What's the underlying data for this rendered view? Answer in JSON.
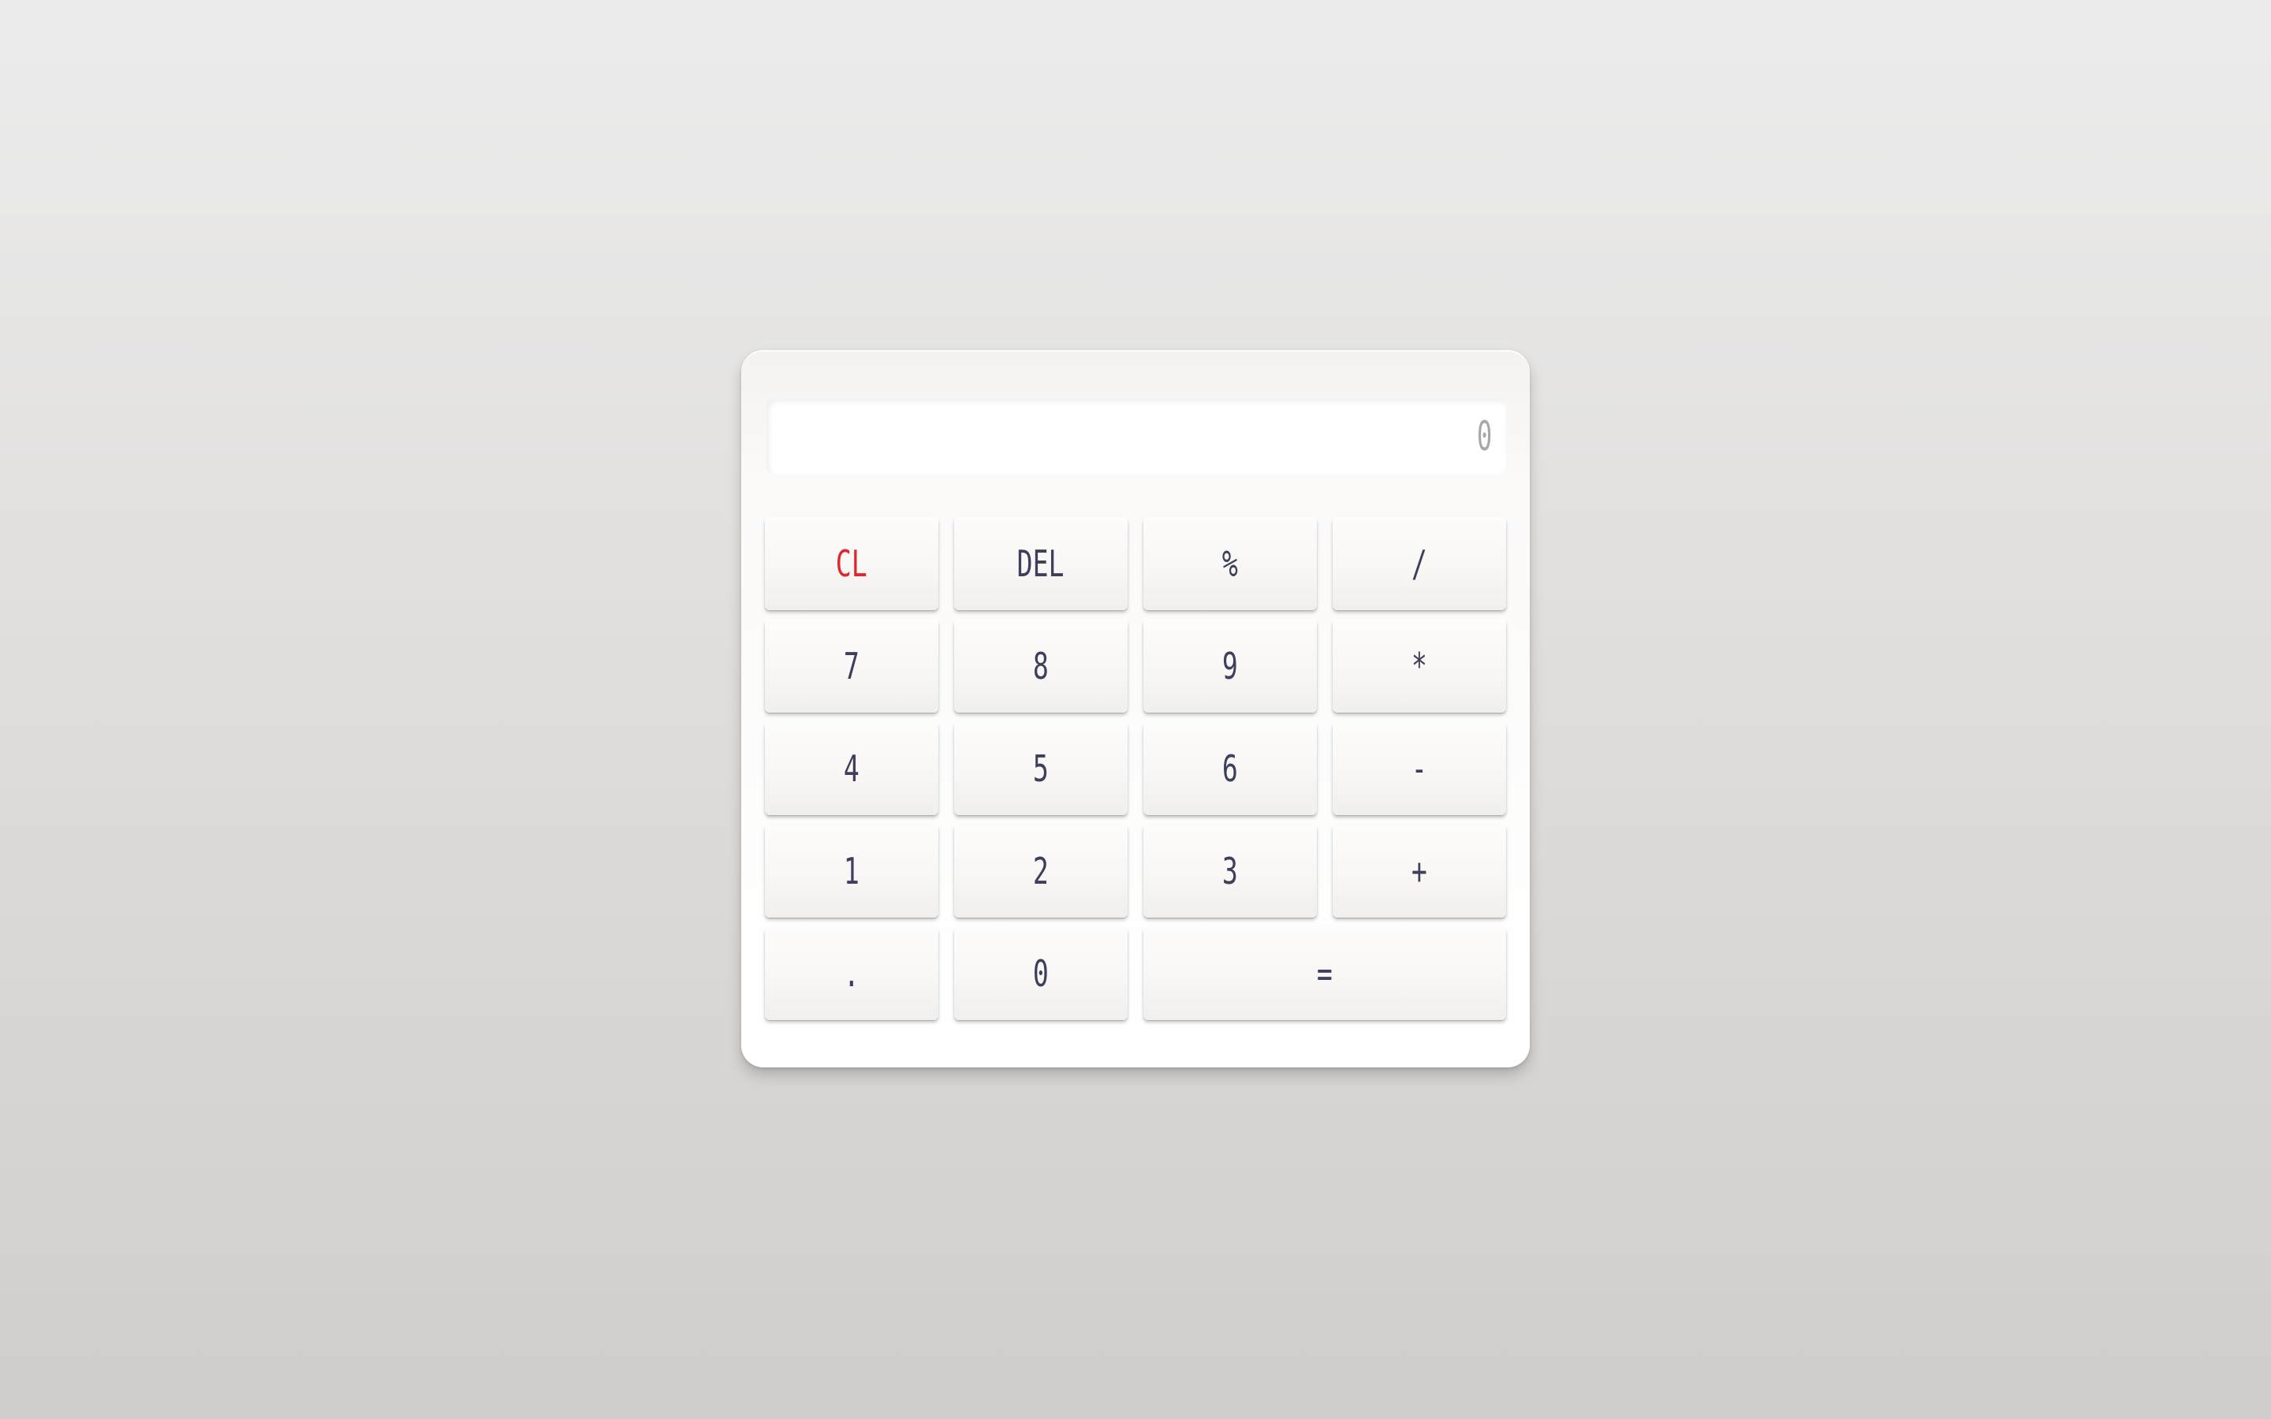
{
  "calculator": {
    "display": {
      "value": "0"
    },
    "keys": [
      {
        "label": "CL",
        "name": "clear-button",
        "style": "danger"
      },
      {
        "label": "DEL",
        "name": "delete-button",
        "style": "normal"
      },
      {
        "label": "%",
        "name": "percent-button",
        "style": "normal"
      },
      {
        "label": "/",
        "name": "divide-button",
        "style": "normal"
      },
      {
        "label": "7",
        "name": "digit-7-button",
        "style": "normal"
      },
      {
        "label": "8",
        "name": "digit-8-button",
        "style": "normal"
      },
      {
        "label": "9",
        "name": "digit-9-button",
        "style": "normal"
      },
      {
        "label": "*",
        "name": "multiply-button",
        "style": "normal"
      },
      {
        "label": "4",
        "name": "digit-4-button",
        "style": "normal"
      },
      {
        "label": "5",
        "name": "digit-5-button",
        "style": "normal"
      },
      {
        "label": "6",
        "name": "digit-6-button",
        "style": "normal"
      },
      {
        "label": "-",
        "name": "subtract-button",
        "style": "normal"
      },
      {
        "label": "1",
        "name": "digit-1-button",
        "style": "normal"
      },
      {
        "label": "2",
        "name": "digit-2-button",
        "style": "normal"
      },
      {
        "label": "3",
        "name": "digit-3-button",
        "style": "normal"
      },
      {
        "label": "+",
        "name": "add-button",
        "style": "normal"
      },
      {
        "label": ".",
        "name": "decimal-button",
        "style": "normal"
      },
      {
        "label": "0",
        "name": "digit-0-button",
        "style": "normal"
      },
      {
        "label": "=",
        "name": "equals-button",
        "style": "wide"
      }
    ]
  },
  "colors": {
    "key_text": "#3d3f5c",
    "clear_text": "#e0262d",
    "display_text": "#a9a9ab",
    "body": "#ffffff"
  }
}
